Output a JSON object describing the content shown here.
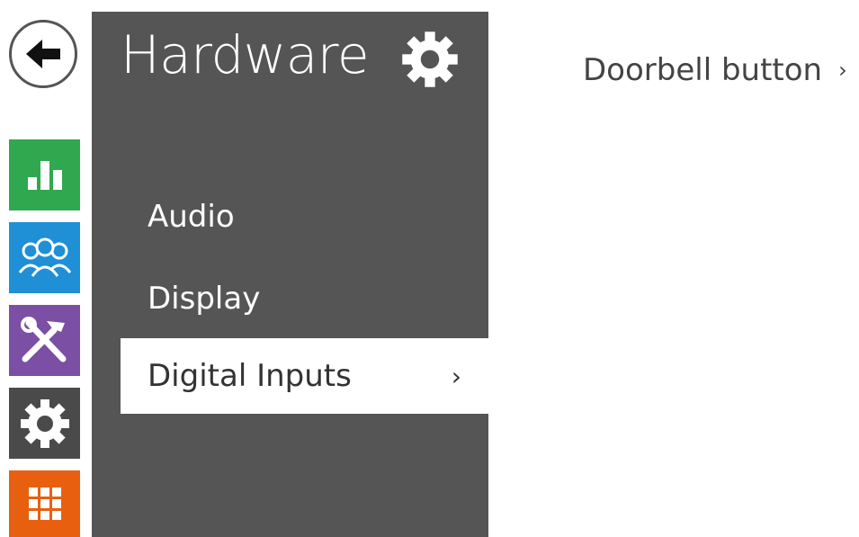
{
  "colors": {
    "panel_bg": "#555555",
    "status_tile": "#2fa84f",
    "users_tile": "#1f8fd6",
    "services_tile": "#7b4fa3",
    "hardware_tile": "#4a4a4a",
    "system_tile": "#e8600f"
  },
  "left_rail": {
    "back_icon": "arrow-left-icon",
    "tiles": [
      {
        "name": "status",
        "icon": "bar-chart-icon"
      },
      {
        "name": "users",
        "icon": "users-icon"
      },
      {
        "name": "services",
        "icon": "tools-icon"
      },
      {
        "name": "hardware",
        "icon": "gear-icon"
      },
      {
        "name": "system",
        "icon": "grid-icon"
      }
    ]
  },
  "side_panel": {
    "title": "Hardware",
    "title_icon": "gear-icon",
    "items": [
      {
        "label": "Audio"
      },
      {
        "label": "Display"
      },
      {
        "label": "Digital Inputs",
        "chevron": "›"
      }
    ]
  },
  "main": {
    "breadcrumb": "Doorbell button",
    "breadcrumb_chevron": "›"
  }
}
